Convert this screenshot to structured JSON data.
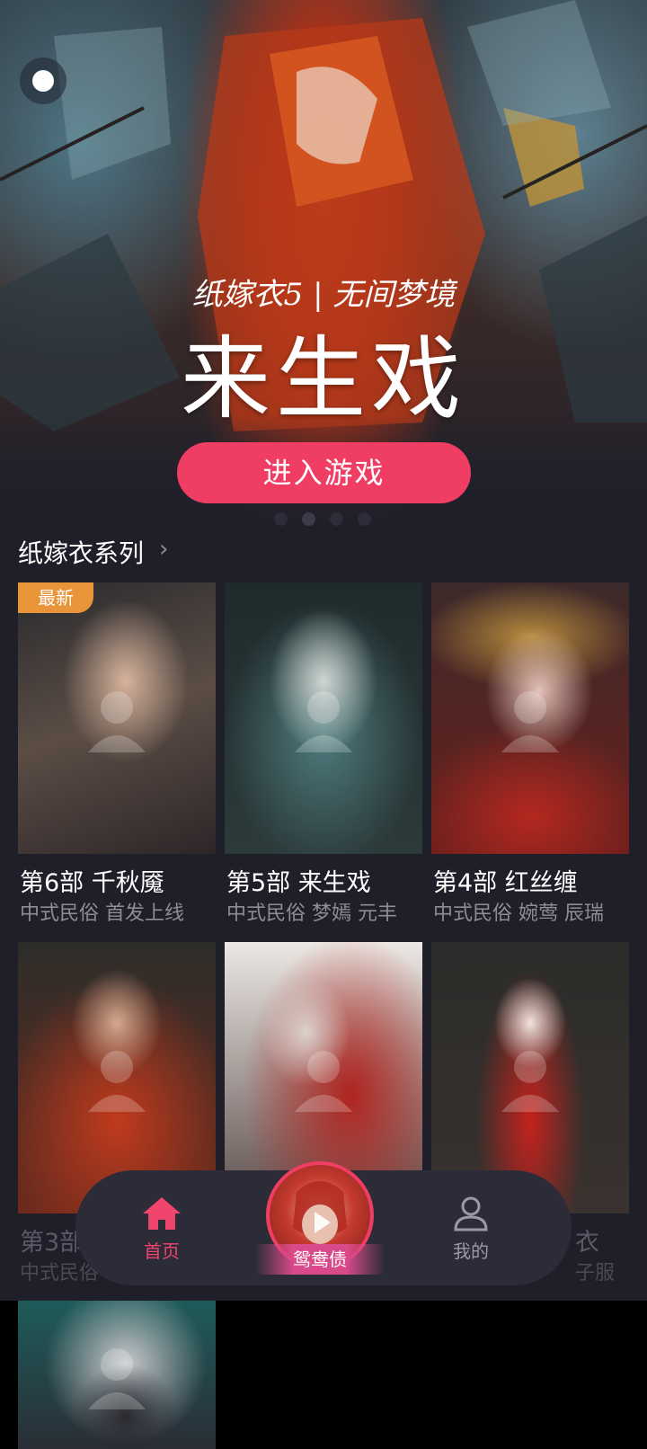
{
  "hero": {
    "subtitle": "纸嫁衣5 | 无间梦境",
    "title": "来生戏",
    "enter_button": "进入游戏",
    "carousel_count": 4,
    "carousel_active_index": 1
  },
  "section": {
    "title": "纸嫁衣系列",
    "chevron": "›"
  },
  "games": [
    {
      "badge": "最新",
      "title": "第6部 千秋魇",
      "tags": "中式民俗 首发上线"
    },
    {
      "badge": "",
      "title": "第5部 来生戏",
      "tags": "中式民俗 梦嫣 元丰"
    },
    {
      "badge": "",
      "title": "第4部 红丝缠",
      "tags": "中式民俗 婉莺 辰瑞"
    },
    {
      "badge": "",
      "title": "第3部",
      "tags": "中式民俗"
    },
    {
      "badge": "",
      "title": "",
      "tags": ""
    },
    {
      "badge": "",
      "title": "衣",
      "tags": "子服"
    },
    {
      "badge": "",
      "title": "",
      "tags": ""
    }
  ],
  "nav": {
    "home_label": "首页",
    "center_label": "鸳鸯债",
    "me_label": "我的"
  },
  "colors": {
    "accent": "#ef3d64",
    "background": "#1f1f2a",
    "badge": "#e8953a",
    "nav_bar": "#2c2c38"
  }
}
